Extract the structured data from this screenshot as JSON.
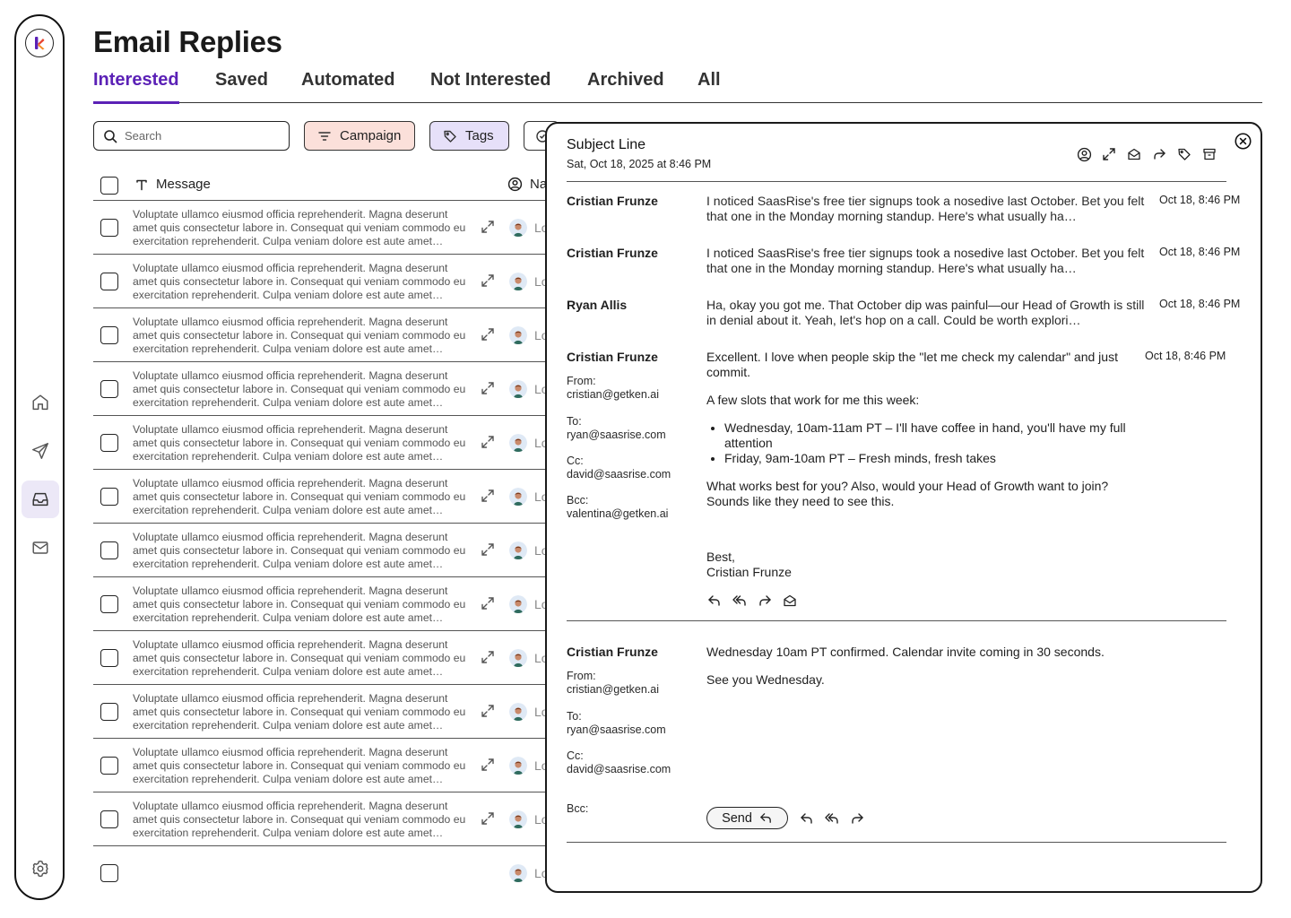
{
  "page": {
    "title": "Email Replies"
  },
  "tabs": [
    {
      "label": "Interested",
      "active": true
    },
    {
      "label": "Saved",
      "active": false
    },
    {
      "label": "Automated",
      "active": false
    },
    {
      "label": "Not Interested",
      "active": false
    },
    {
      "label": "Archived",
      "active": false
    },
    {
      "label": "All",
      "active": false
    }
  ],
  "toolbar": {
    "search_placeholder": "Search",
    "campaign_label": "Campaign",
    "tags_label": "Tags"
  },
  "table": {
    "columns": {
      "message": "Message",
      "name": "Na"
    },
    "row_message": "Voluptate ullamco eiusmod officia reprehenderit. Magna deserunt amet quis consectetur labore in. Consequat qui veniam commodo eu exercitation reprehenderit. Culpa veniam dolore est aute amet…",
    "row_name": "Lo",
    "rows": [
      {
        "message": "Voluptate ullamco eiusmod officia reprehenderit. Magna deserunt amet quis consectetur labore in. Consequat qui veniam commodo eu exercitation reprehenderit. Culpa veniam dolore est aute amet…",
        "name": "Lo"
      },
      {
        "message": "Voluptate ullamco eiusmod officia reprehenderit. Magna deserunt amet quis consectetur labore in. Consequat qui veniam commodo eu exercitation reprehenderit. Culpa veniam dolore est aute amet…",
        "name": "Lo"
      },
      {
        "message": "Voluptate ullamco eiusmod officia reprehenderit. Magna deserunt amet quis consectetur labore in. Consequat qui veniam commodo eu exercitation reprehenderit. Culpa veniam dolore est aute amet…",
        "name": "Lo"
      },
      {
        "message": "Voluptate ullamco eiusmod officia reprehenderit. Magna deserunt amet quis consectetur labore in. Consequat qui veniam commodo eu exercitation reprehenderit. Culpa veniam dolore est aute amet…",
        "name": "Lo"
      },
      {
        "message": "Voluptate ullamco eiusmod officia reprehenderit. Magna deserunt amet quis consectetur labore in. Consequat qui veniam commodo eu exercitation reprehenderit. Culpa veniam dolore est aute amet…",
        "name": "Lo"
      },
      {
        "message": "Voluptate ullamco eiusmod officia reprehenderit. Magna deserunt amet quis consectetur labore in. Consequat qui veniam commodo eu exercitation reprehenderit. Culpa veniam dolore est aute amet…",
        "name": "Lo"
      },
      {
        "message": "Voluptate ullamco eiusmod officia reprehenderit. Magna deserunt amet quis consectetur labore in. Consequat qui veniam commodo eu exercitation reprehenderit. Culpa veniam dolore est aute amet…",
        "name": "Lo"
      },
      {
        "message": "Voluptate ullamco eiusmod officia reprehenderit. Magna deserunt amet quis consectetur labore in. Consequat qui veniam commodo eu exercitation reprehenderit. Culpa veniam dolore est aute amet…",
        "name": "Lo"
      },
      {
        "message": "Voluptate ullamco eiusmod officia reprehenderit. Magna deserunt amet quis consectetur labore in. Consequat qui veniam commodo eu exercitation reprehenderit. Culpa veniam dolore est aute amet…",
        "name": "Lo"
      },
      {
        "message": "Voluptate ullamco eiusmod officia reprehenderit. Magna deserunt amet quis consectetur labore in. Consequat qui veniam commodo eu exercitation reprehenderit. Culpa veniam dolore est aute amet…",
        "name": "Lo"
      },
      {
        "message": "Voluptate ullamco eiusmod officia reprehenderit. Magna deserunt amet quis consectetur labore in. Consequat qui veniam commodo eu exercitation reprehenderit. Culpa veniam dolore est aute amet…",
        "name": "Lo"
      },
      {
        "message": "Voluptate ullamco eiusmod officia reprehenderit. Magna deserunt amet quis consectetur labore in. Consequat qui veniam commodo eu exercitation reprehenderit. Culpa veniam dolore est aute amet…",
        "name": "Lo"
      },
      {
        "message": "",
        "name": "Lo"
      }
    ]
  },
  "sidebar": {
    "icons": [
      "home-icon",
      "send-icon",
      "inbox-icon",
      "mail-icon",
      "settings-icon"
    ],
    "active": "inbox-icon"
  },
  "panel": {
    "subject": "Subject Line",
    "date": "Sat, Oct 18, 2025 at 8:46 PM",
    "thread": [
      {
        "sender": "Cristian Frunze",
        "preview": "I noticed SaasRise's free tier signups took a nosedive last October. Bet you felt that one in the Monday morning standup. Here's what usually ha…",
        "time": "Oct 18, 8:46 PM"
      },
      {
        "sender": "Cristian Frunze",
        "preview": "I noticed SaasRise's free tier signups took a nosedive last October. Bet you felt that one in the Monday morning standup. Here's what usually ha…",
        "time": "Oct 18, 8:46 PM"
      },
      {
        "sender": "Ryan Allis",
        "preview": "Ha, okay you got me. That October dip was painful—our Head of Growth is still in denial about it. Yeah, let's hop on a call. Could be worth explori…",
        "time": "Oct 18, 8:46 PM"
      }
    ],
    "expanded": {
      "sender": "Cristian Frunze",
      "time": "Oct 18, 8:46 PM",
      "from_label": "From:",
      "from": "cristian@getken.ai",
      "to_label": "To:",
      "to": "ryan@saasrise.com",
      "cc_label": "Cc:",
      "cc": "david@saasrise.com",
      "bcc_label": "Bcc:",
      "bcc": "valentina@getken.ai",
      "p1": "Excellent. I love when people skip the \"let me check my calendar\" and just commit.",
      "p2": "A few slots that work for me this week:",
      "bullets": [
        "Wednesday, 10am-11am PT – I'll have coffee in hand, you'll have my full attention",
        "Friday, 9am-10am PT – Fresh minds, fresh takes"
      ],
      "p3": "What works best for you? Also, would your Head of Growth want to join? Sounds like they need to see this.",
      "signoff": "Best,",
      "signature": "Cristian Frunze"
    },
    "draft": {
      "sender": "Cristian Frunze",
      "from_label": "From:",
      "from": "cristian@getken.ai",
      "to_label": "To:",
      "to": "ryan@saasrise.com",
      "cc_label": "Cc:",
      "cc": "david@saasrise.com",
      "bcc_label": "Bcc:",
      "line1": "Wednesday 10am PT confirmed. Calendar invite coming in 30 seconds.",
      "line2": "See you Wednesday.",
      "send_label": "Send"
    }
  },
  "colors": {
    "accent": "#5b21b6",
    "campaign_chip": "#fbe0da",
    "tags_chip": "#e6e0f9",
    "active_nav": "#ece8f7"
  }
}
